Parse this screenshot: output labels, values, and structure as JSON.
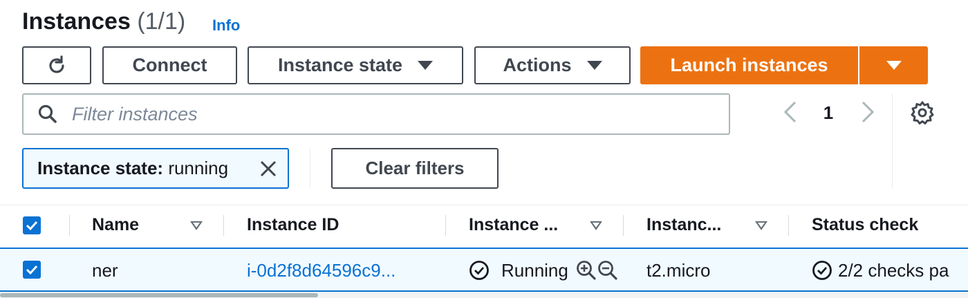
{
  "header": {
    "title": "Instances",
    "count": "(1/1)",
    "info_link": "Info"
  },
  "toolbar": {
    "refresh_icon": "refresh-icon",
    "connect_label": "Connect",
    "instance_state_label": "Instance state",
    "actions_label": "Actions",
    "launch_label": "Launch instances"
  },
  "search": {
    "placeholder": "Filter instances",
    "value": ""
  },
  "pagination": {
    "current_page": "1"
  },
  "filters": {
    "token_key": "Instance state:",
    "token_value": "running",
    "clear_label": "Clear filters"
  },
  "table": {
    "columns": [
      "Name",
      "Instance ID",
      "Instance ...",
      "Instanc...",
      "Status check"
    ],
    "rows": [
      {
        "selected": true,
        "name": "ner",
        "instance_id": "i-0d2f8d64596c9...",
        "state": "Running",
        "type": "t2.micro",
        "status_check": "2/2 checks pa"
      }
    ]
  },
  "colors": {
    "accent": "#0972d3",
    "primary_button": "#ec7211",
    "text": "#16191f",
    "border": "#414750"
  }
}
